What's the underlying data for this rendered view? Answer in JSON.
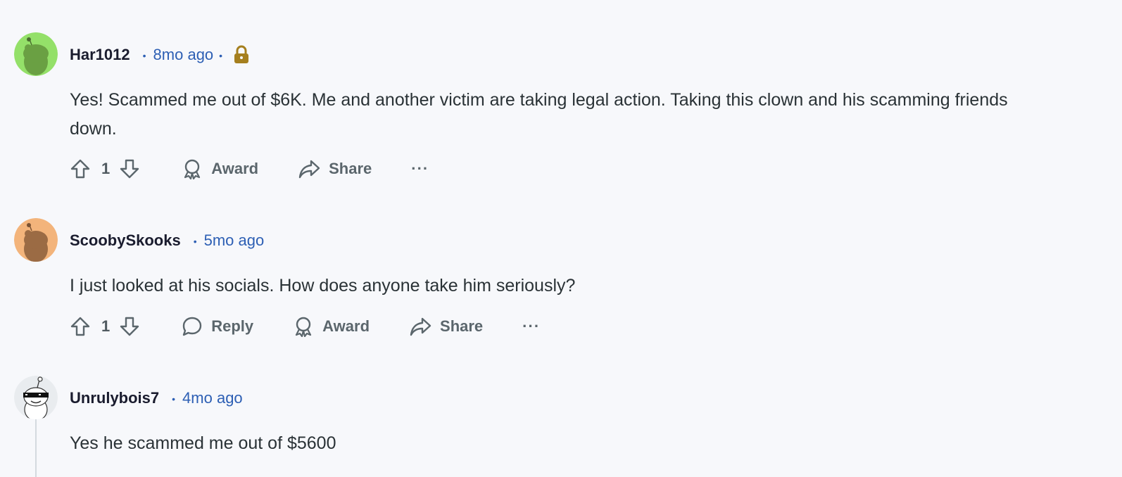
{
  "comments": [
    {
      "username": "Har1012",
      "time": "8mo ago",
      "avatar_color": "#94e069",
      "has_lock": true,
      "body": "Yes! Scammed me out of $6K. Me and another victim are taking legal action. Taking this clown and his scamming friends down.",
      "score": "1",
      "actions": {
        "award": "Award",
        "share": "Share",
        "more": "···"
      }
    },
    {
      "username": "ScoobySkooks",
      "time": "5mo ago",
      "avatar_color": "#f3b47b",
      "body": "I just looked at his socials. How does anyone take him seriously?",
      "score": "1",
      "actions": {
        "reply": "Reply",
        "award": "Award",
        "share": "Share",
        "more": "···"
      }
    },
    {
      "username": "Unrulybois7",
      "time": "4mo ago",
      "avatar_color": "#e9ecef",
      "body": "Yes he scammed me out of $5600"
    }
  ],
  "meta_separator": "•",
  "colors": {
    "link_blue": "#2d5fb4",
    "text": "#2a3236",
    "action_gray": "#5b666c",
    "lock_gold": "#a57f1e",
    "background": "#f7f8fb"
  },
  "icons": [
    "upvote-icon",
    "downvote-icon",
    "award-icon",
    "share-icon",
    "reply-icon",
    "lock-icon",
    "more-icon"
  ]
}
